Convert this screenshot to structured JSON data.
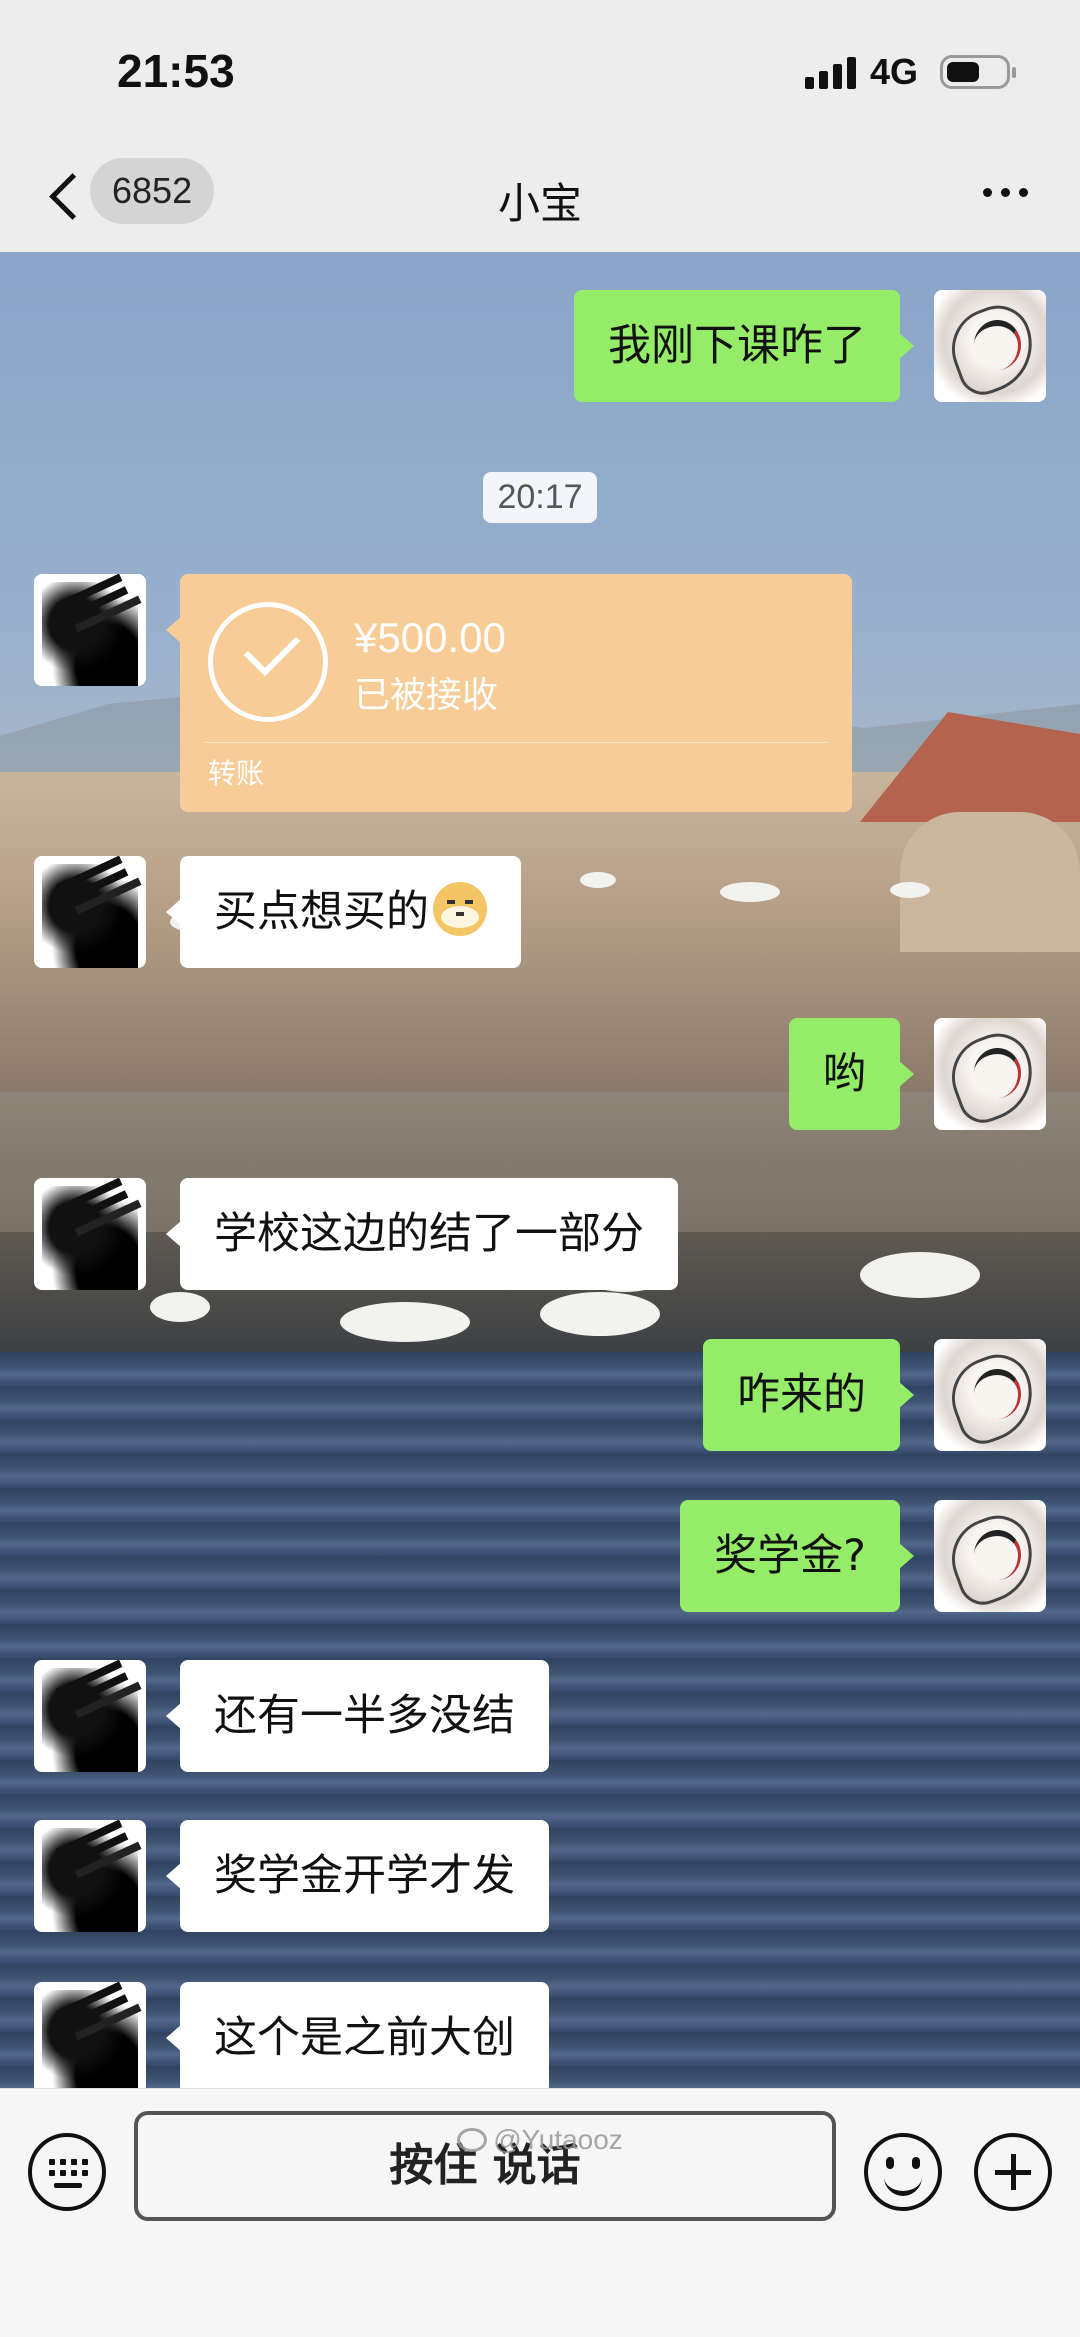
{
  "status_bar": {
    "time": "21:53",
    "network": "4G"
  },
  "nav": {
    "unread_count": "6852",
    "title": "小宝"
  },
  "messages": [
    {
      "type": "text",
      "from": "self",
      "text": "我刚下课咋了"
    },
    {
      "type": "time",
      "text": "20:17"
    },
    {
      "type": "transfer",
      "from": "peer",
      "amount": "¥500.00",
      "status": "已被接收",
      "label": "转账"
    },
    {
      "type": "text",
      "from": "peer",
      "text": "买点想买的",
      "emoji": "doge"
    },
    {
      "type": "text",
      "from": "self",
      "text": "哟"
    },
    {
      "type": "text",
      "from": "peer",
      "text": "学校这边的结了一部分"
    },
    {
      "type": "text",
      "from": "self",
      "text": "咋来的"
    },
    {
      "type": "text",
      "from": "self",
      "text": "奖学金?"
    },
    {
      "type": "text",
      "from": "peer",
      "text": "还有一半多没结"
    },
    {
      "type": "text",
      "from": "peer",
      "text": "奖学金开学才发"
    },
    {
      "type": "text",
      "from": "peer",
      "text": "这个是之前大创"
    }
  ],
  "input_bar": {
    "hold_to_talk_label": "按住 说话"
  },
  "watermark": "@Yutaooz",
  "colors": {
    "self_bubble": "#95ec69",
    "peer_bubble": "#ffffff",
    "transfer_card": "#f8cc97",
    "header_bg": "#ededed"
  },
  "icons": [
    "back-icon",
    "more-icon",
    "keyboard-icon",
    "emoji-icon",
    "plus-icon",
    "check-icon",
    "signal-icon",
    "battery-icon"
  ]
}
